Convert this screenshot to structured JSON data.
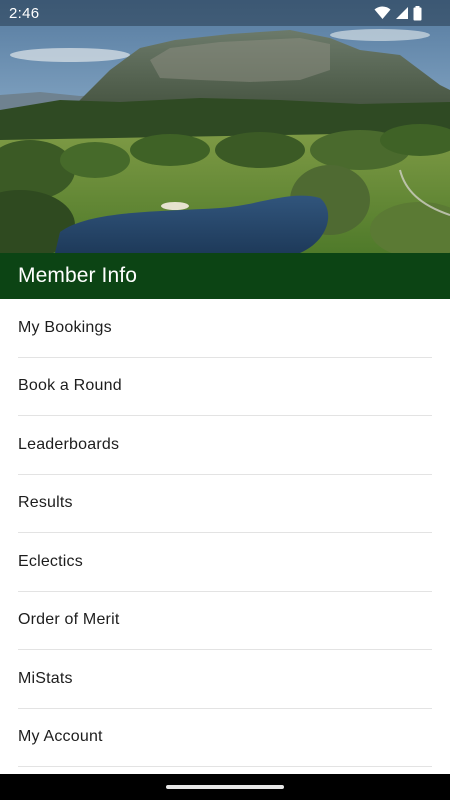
{
  "status_bar": {
    "time": "2:46",
    "icons": [
      "wifi-icon",
      "cellular-signal-icon",
      "battery-icon"
    ]
  },
  "hero": {
    "image": "golf-course-landscape",
    "description_colors": {
      "sky": "#6e94b8",
      "mountain": "#4c5b4a",
      "grass": "#6a8a3a",
      "water": "#2d4f73"
    }
  },
  "section": {
    "title": "Member Info",
    "header_color": "#0c4414"
  },
  "menu": {
    "items": [
      {
        "label": "My Bookings"
      },
      {
        "label": "Book a Round"
      },
      {
        "label": "Leaderboards"
      },
      {
        "label": "Results"
      },
      {
        "label": "Eclectics"
      },
      {
        "label": "Order of Merit"
      },
      {
        "label": "MiStats"
      },
      {
        "label": "My Account"
      }
    ]
  }
}
